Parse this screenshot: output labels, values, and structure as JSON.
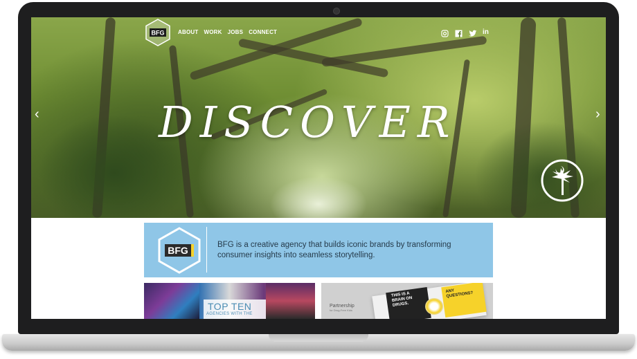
{
  "brand": {
    "logo_text": "BFG"
  },
  "nav": {
    "items": [
      "ABOUT",
      "WORK",
      "JOBS",
      "CONNECT"
    ]
  },
  "social": {
    "icons": [
      "instagram-icon",
      "facebook-icon",
      "twitter-icon",
      "linkedin-icon"
    ],
    "labels": {
      "linkedin": "in"
    }
  },
  "hero": {
    "headline": "DISCOVER",
    "prev_arrow": "‹",
    "next_arrow": "›"
  },
  "intro": {
    "logo_text": "BFG",
    "tagline": "BFG is a creative agency that builds iconic brands by transforming consumer insights into seamless storytelling."
  },
  "features": [
    {
      "title": "TOP TEN",
      "subtitle": "AGENCIES WITH THE"
    },
    {
      "partner": "Partnership",
      "partner_sub": "for Drug-Free Kids",
      "ad_left": "THIS IS A BRAIN ON DRUGS.",
      "ad_right": "ANY QUESTIONS?"
    }
  ],
  "colors": {
    "banner": "#8fc6e7",
    "frame": "#1e1e1f",
    "accent_yellow": "#f6d22a"
  }
}
